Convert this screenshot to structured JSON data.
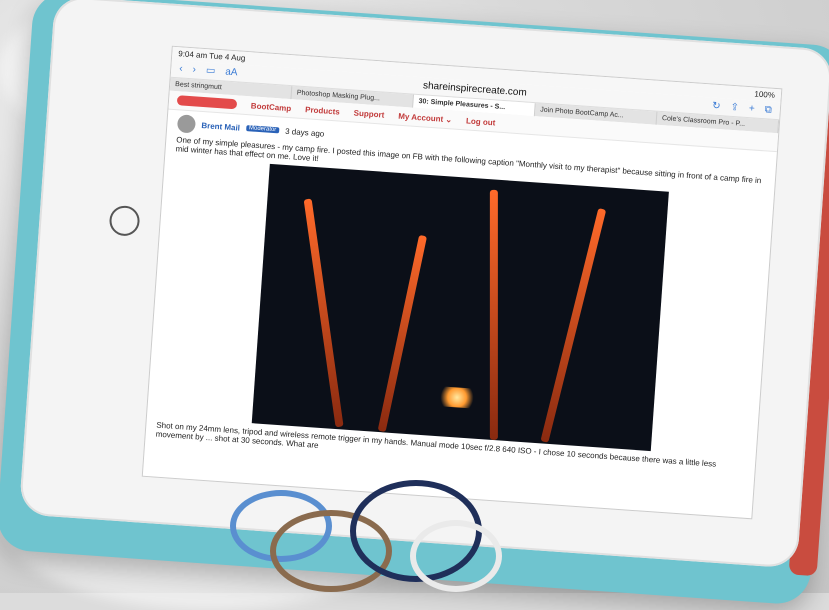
{
  "browser": {
    "status_time": "9:04 am  Tue 4 Aug",
    "battery": "100%",
    "url": "shareinspirecreate.com",
    "tabs": [
      "Best stringmutt",
      "Photoshop Masking Plug...",
      "30: Simple Pleasures - S...",
      "Join Photo BootCamp Ac...",
      "Cole's Classroom Pro - P..."
    ]
  },
  "site": {
    "menu": [
      "BootCamp",
      "Products",
      "Support",
      "My Account ⌄",
      "Log out"
    ]
  },
  "post": {
    "author": "Brent Mail",
    "badge": "Moderator",
    "time": "3 days ago",
    "text1": "One of my simple pleasures - my camp fire. I posted this image on FB with the following caption \"Monthly visit to my therapist\" because sitting in front of a camp fire in mid winter has that effect on me. Love it!",
    "text2": "Shot on my 24mm lens, tripod and wireless remote trigger in my hands. Manual mode 10sec f/2.8 640 ISO - I chose 10 seconds because there was a little less movement by ... shot at 30 seconds. What are"
  }
}
